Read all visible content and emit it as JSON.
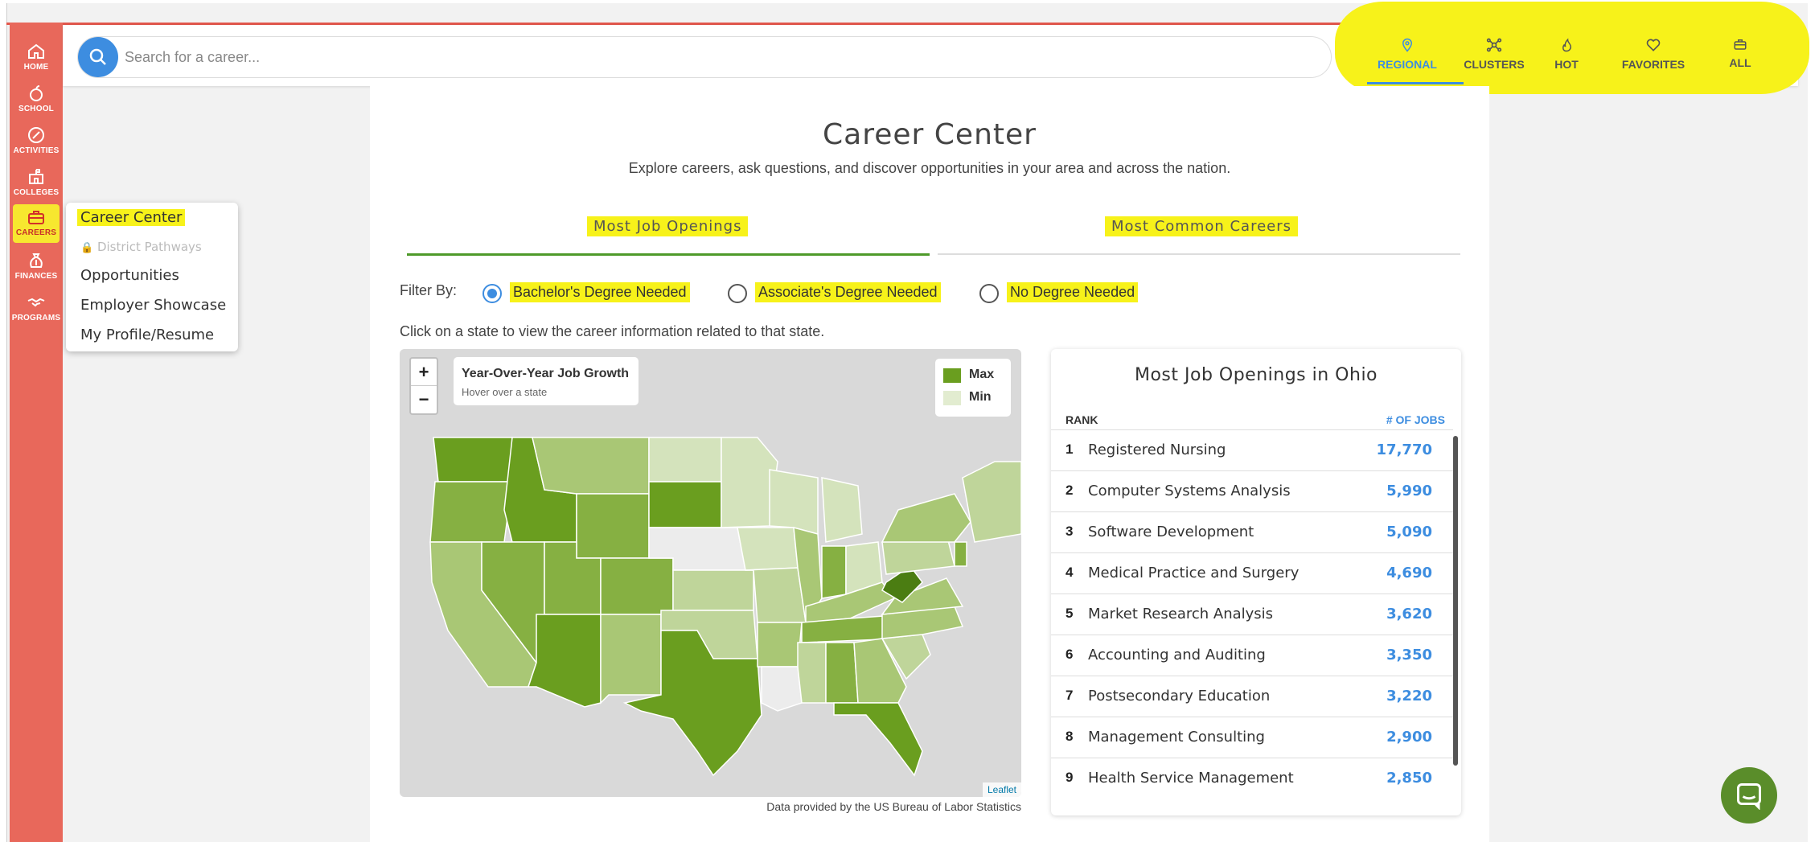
{
  "sidebar": {
    "items": [
      {
        "label": "HOME",
        "icon": "home-icon"
      },
      {
        "label": "SCHOOL",
        "icon": "apple-icon"
      },
      {
        "label": "ACTIVITIES",
        "icon": "compass-icon"
      },
      {
        "label": "COLLEGES",
        "icon": "building-icon"
      },
      {
        "label": "CAREERS",
        "icon": "briefcase-icon"
      },
      {
        "label": "FINANCES",
        "icon": "money-bag-icon"
      },
      {
        "label": "PROGRAMS",
        "icon": "handshake-icon"
      }
    ],
    "active": "CAREERS"
  },
  "careers_menu": {
    "items": [
      "Career Center",
      "District Pathways",
      "Opportunities",
      "Employer Showcase",
      "My Profile/Resume"
    ]
  },
  "search": {
    "placeholder": "Search for a career..."
  },
  "nav": {
    "items": [
      {
        "label": "REGIONAL",
        "icon": "map-pin-icon"
      },
      {
        "label": "CLUSTERS",
        "icon": "network-icon"
      },
      {
        "label": "HOT",
        "icon": "flame-icon"
      },
      {
        "label": "FAVORITES",
        "icon": "heart-icon"
      },
      {
        "label": "ALL",
        "icon": "briefcase-icon"
      }
    ],
    "active": "REGIONAL"
  },
  "page": {
    "title": "Career Center",
    "subtitle": "Explore careers, ask questions, and discover opportunities in your area and across the nation."
  },
  "tabs": [
    "Most Job Openings",
    "Most Common Careers"
  ],
  "filter": {
    "label": "Filter By:",
    "options": [
      "Bachelor's Degree Needed",
      "Associate's Degree Needed",
      "No Degree Needed"
    ],
    "selected": "Bachelor's Degree Needed"
  },
  "instruction": "Click on a state to view the career information related to that state.",
  "map": {
    "zoom_in": "+",
    "zoom_out": "−",
    "info_title": "Year-Over-Year Job Growth",
    "info_hint": "Hover over a state",
    "legend": [
      {
        "label": "Max",
        "color": "#6a9e1f"
      },
      {
        "label": "Min",
        "color": "#e2ecd0"
      }
    ],
    "attribution": "Leaflet",
    "source": "Data provided by the US Bureau of Labor Statistics"
  },
  "ranking": {
    "title": "Most Job Openings in Ohio",
    "col_rank": "RANK",
    "col_jobs": "# OF JOBS",
    "rows": [
      {
        "rank": "1",
        "name": "Registered Nursing",
        "jobs": "17,770"
      },
      {
        "rank": "2",
        "name": "Computer Systems Analysis",
        "jobs": "5,990"
      },
      {
        "rank": "3",
        "name": "Software Development",
        "jobs": "5,090"
      },
      {
        "rank": "4",
        "name": "Medical Practice and Surgery",
        "jobs": "4,690"
      },
      {
        "rank": "5",
        "name": "Market Research Analysis",
        "jobs": "3,620"
      },
      {
        "rank": "6",
        "name": "Accounting and Auditing",
        "jobs": "3,350"
      },
      {
        "rank": "7",
        "name": "Postsecondary Education",
        "jobs": "3,220"
      },
      {
        "rank": "8",
        "name": "Management Consulting",
        "jobs": "2,900"
      },
      {
        "rank": "9",
        "name": "Health Service Management",
        "jobs": "2,850"
      }
    ]
  },
  "colors": {
    "sidebar": "#e8685b",
    "accent": "#3d8de0",
    "highlight": "#f7f21a",
    "green_dark": "#6a9e1f",
    "chat": "#5a8d2a"
  }
}
